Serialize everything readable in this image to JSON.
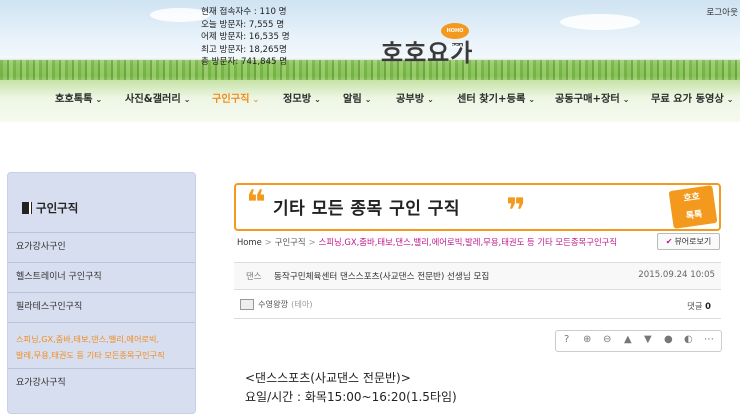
{
  "header": {
    "stats": [
      "현재 접속자수 : 110 명",
      "오늘 방문자: 7,555 명",
      "어제 방문자: 16,535 명",
      "최고 방문자: 18,265명",
      "총 방문자: 741,845 명"
    ],
    "logo_text": "호호요가",
    "logo_badge": "HOHO YOGA",
    "login_label": "로그아웃"
  },
  "nav": {
    "items": [
      {
        "label": "호호톡톡",
        "chevron": "⌄"
      },
      {
        "label": "사진&갤러리",
        "chevron": "⌄"
      },
      {
        "label": "구인구직",
        "chevron": "⌄"
      },
      {
        "label": "정모방",
        "chevron": "⌄"
      },
      {
        "label": "알림",
        "chevron": "⌄"
      },
      {
        "label": "공부방",
        "chevron": "⌄"
      },
      {
        "label": "센터 찾기+등록",
        "chevron": "⌄"
      },
      {
        "label": "공동구매+장터",
        "chevron": "⌄"
      },
      {
        "label": "무료 요가 동영상",
        "chevron": "⌄"
      }
    ],
    "active_color": "#f28b1e"
  },
  "sidebar": {
    "title": "구인구직",
    "items": [
      "요가강사구인",
      "헬스트레이너 구인구직",
      "필라테스구인구직",
      "스피닝,GX,줌바,태보,댄스,밸리,에어로빅,\n발레,무용,태권도 등 기타 모든종목구인구직",
      "요가강사구직"
    ]
  },
  "board": {
    "banner_title": "기타 모든 종목 구인 구직",
    "banner_open_quote": "❝",
    "banner_close_quote": "❞",
    "banner_stamp": "호호\n톡톡",
    "breadcrumb": {
      "home": "Home",
      "level1": "구인구직",
      "level2": "스피닝,GX,줌바,태보,댄스,밸리,에어로빅,발레,무용,태권도 등 기타 모든종목구인구직"
    },
    "view_button": "뷰어로보기",
    "view_check": "✔",
    "post": {
      "category": "댄스",
      "title": "동작구민체육센터 댄스스포츠(사교댄스 전문반) 선생님 모집",
      "date": "2015.09.24 10:05",
      "author": "수영왕깡",
      "author_sub": "(테아)",
      "comments_label": "댓글",
      "comments_count": "0"
    },
    "toolbar_icons": [
      {
        "name": "help-icon",
        "glyph": "?"
      },
      {
        "name": "zoom-in-icon",
        "glyph": "⊕"
      },
      {
        "name": "zoom-out-icon",
        "glyph": "⊖"
      },
      {
        "name": "arrow-up-icon",
        "glyph": "▲"
      },
      {
        "name": "arrow-down-icon",
        "glyph": "▼"
      },
      {
        "name": "comment-icon",
        "glyph": "●"
      },
      {
        "name": "share-icon",
        "glyph": "◐"
      },
      {
        "name": "more-icon",
        "glyph": "⋯"
      }
    ],
    "body_lines": [
      "<댄스스포츠(사교댄스 전문반)>",
      "요일/시간 : 화목15:00~16:20(1.5타임)"
    ]
  }
}
